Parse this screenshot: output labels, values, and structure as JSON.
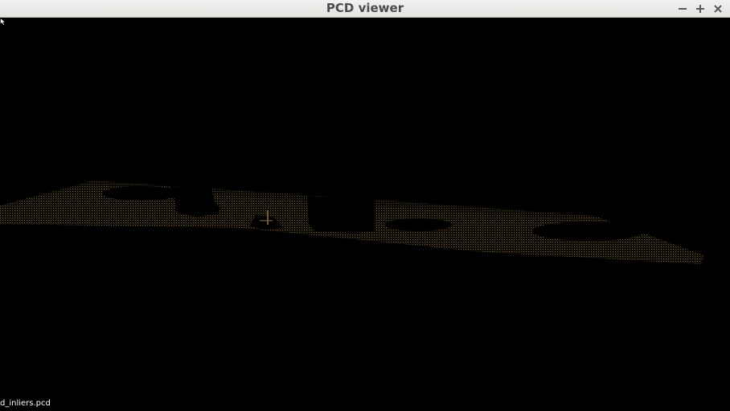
{
  "window": {
    "title": "PCD viewer",
    "controls": {
      "minimize_icon": "minimize-icon",
      "maximize_icon": "maximize-icon",
      "close_icon": "close-icon"
    }
  },
  "viewer": {
    "background_color": "#000000",
    "point_color": "#8a6c46",
    "filename_label": "d_inliers.pcd"
  }
}
